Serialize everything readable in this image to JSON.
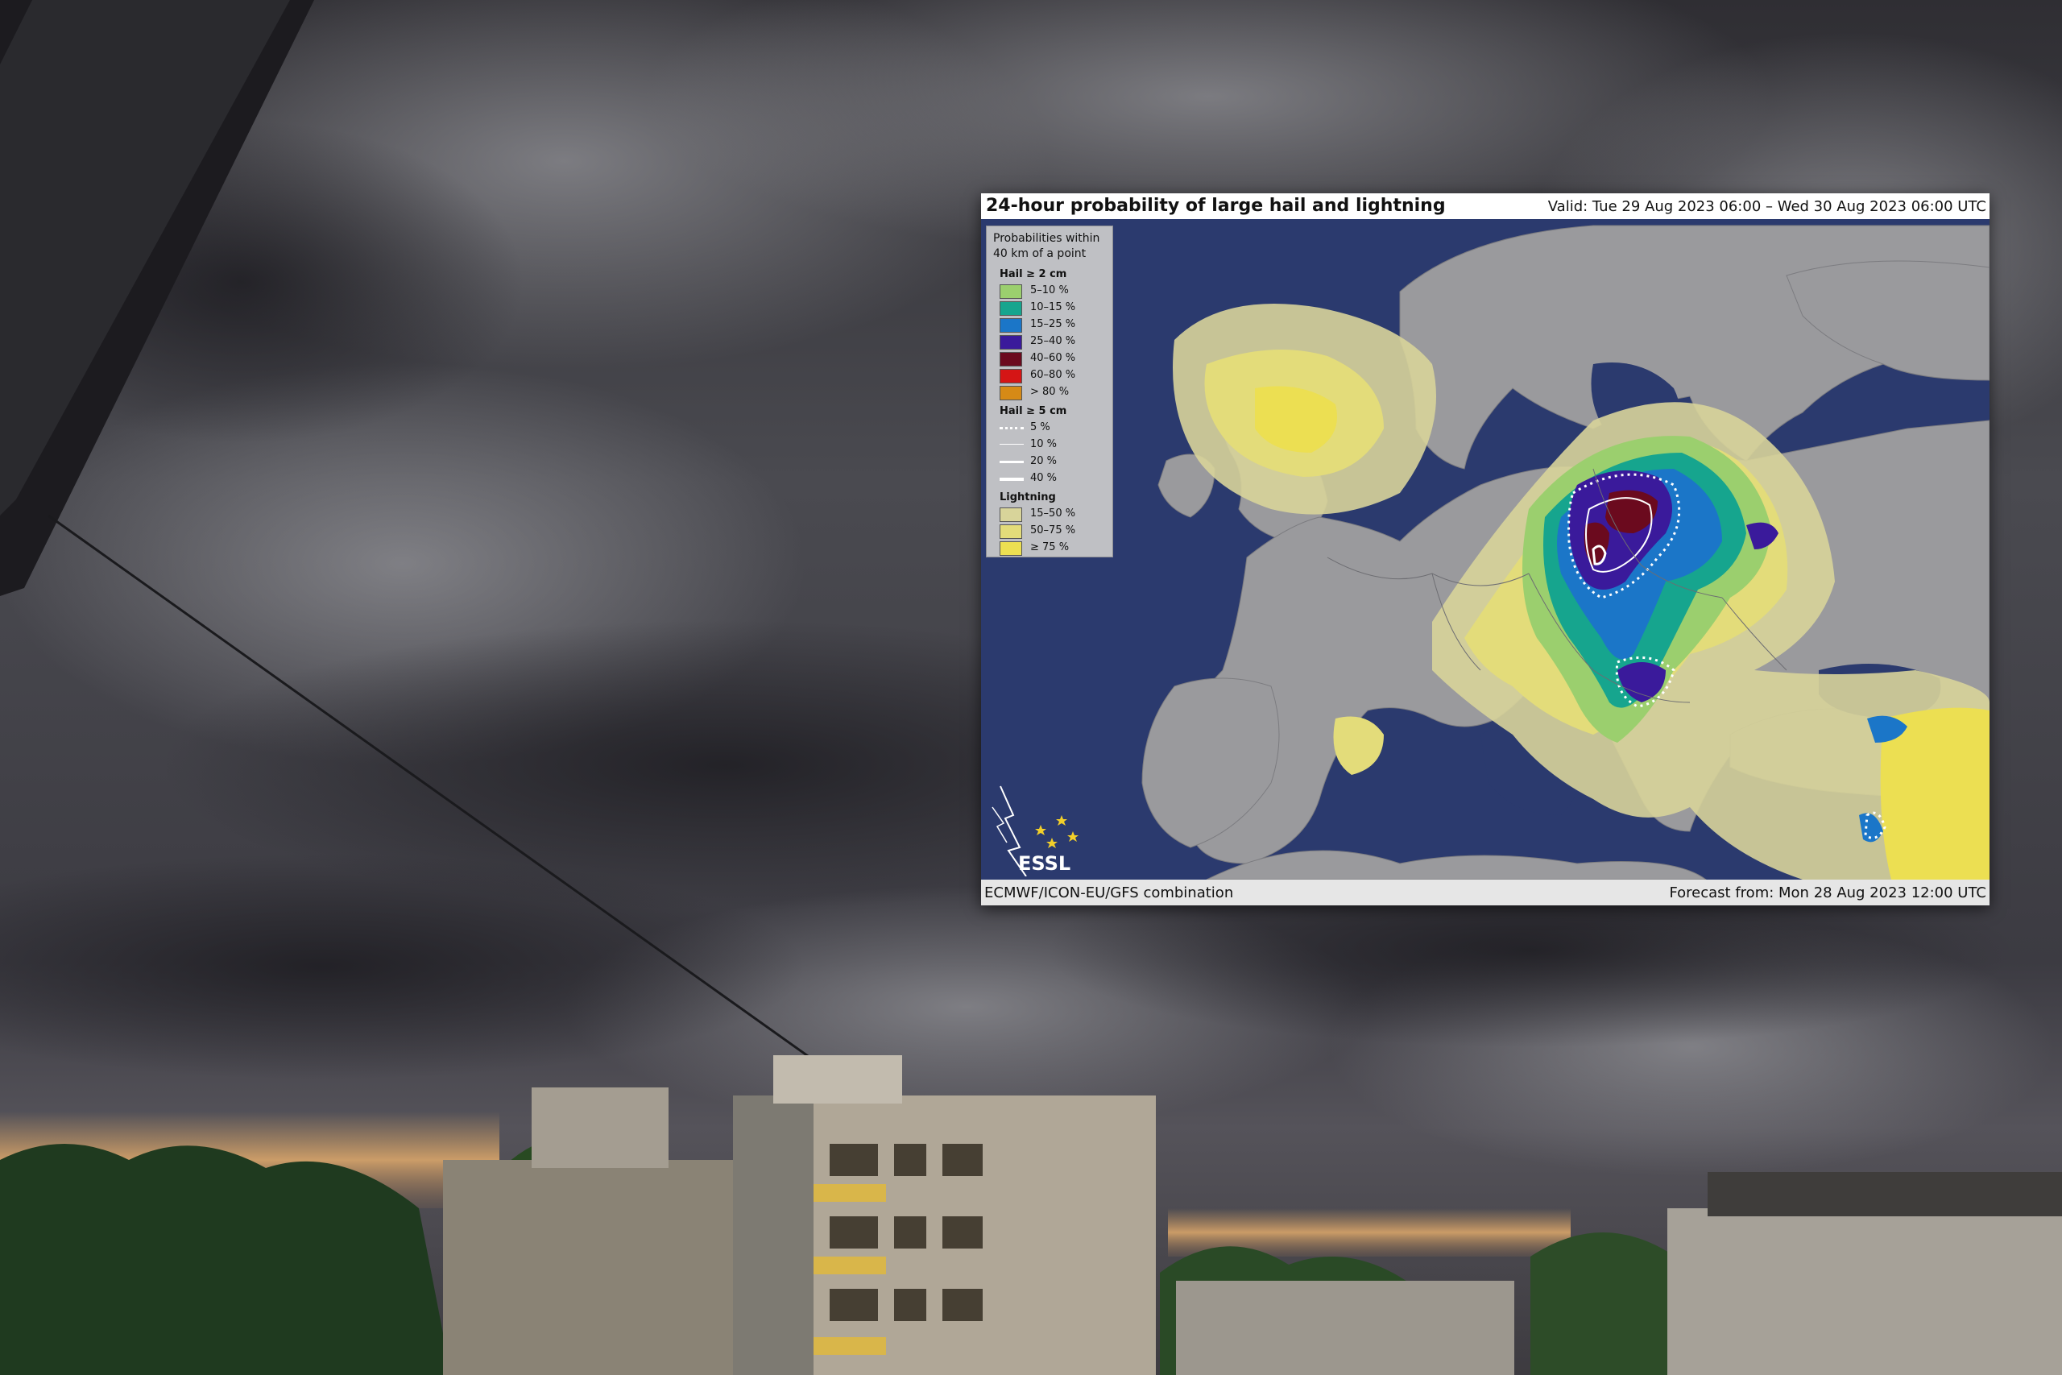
{
  "map": {
    "title": "24-hour probability of large hail and lightning",
    "valid": "Valid: Tue 29 Aug 2023 06:00 – Wed 30 Aug 2023 06:00 UTC",
    "source": "ECMWF/ICON-EU/GFS combination",
    "forecast": "Forecast from: Mon 28 Aug 2023 12:00 UTC",
    "logo_text": "ESSL",
    "colors": {
      "sea": "#2b3a6e",
      "land": "#9a9a9d",
      "lightning_low": "#d8d49a",
      "lightning_mid": "#e3dc7a",
      "lightning_high": "#ecdf52"
    }
  },
  "legend": {
    "intro_line1": "Probabilities within",
    "intro_line2": "40 km of a point",
    "hail2": {
      "heading": "Hail ≥ 2 cm",
      "items": [
        {
          "label": "5–10 %",
          "color": "#9bcf6e"
        },
        {
          "label": "10–15 %",
          "color": "#16a58e"
        },
        {
          "label": "15–25 %",
          "color": "#1b76c8"
        },
        {
          "label": "25–40 %",
          "color": "#3a1a9b"
        },
        {
          "label": "40–60 %",
          "color": "#6b0a1e"
        },
        {
          "label": "60–80 %",
          "color": "#d51515"
        },
        {
          "label": "> 80 %",
          "color": "#d68a16"
        }
      ]
    },
    "hail5": {
      "heading": "Hail ≥ 5 cm",
      "items": [
        {
          "label": "5 %",
          "style": "dotted"
        },
        {
          "label": "10 %",
          "style": "thin"
        },
        {
          "label": "20 %",
          "style": "medium"
        },
        {
          "label": "40 %",
          "style": "thick"
        }
      ]
    },
    "lightning": {
      "heading": "Lightning",
      "items": [
        {
          "label": "15–50 %",
          "color": "#d8d49a"
        },
        {
          "label": "50–75 %",
          "color": "#e3dc7a"
        },
        {
          "label": "≥ 75 %",
          "color": "#ecdf52"
        }
      ]
    }
  }
}
